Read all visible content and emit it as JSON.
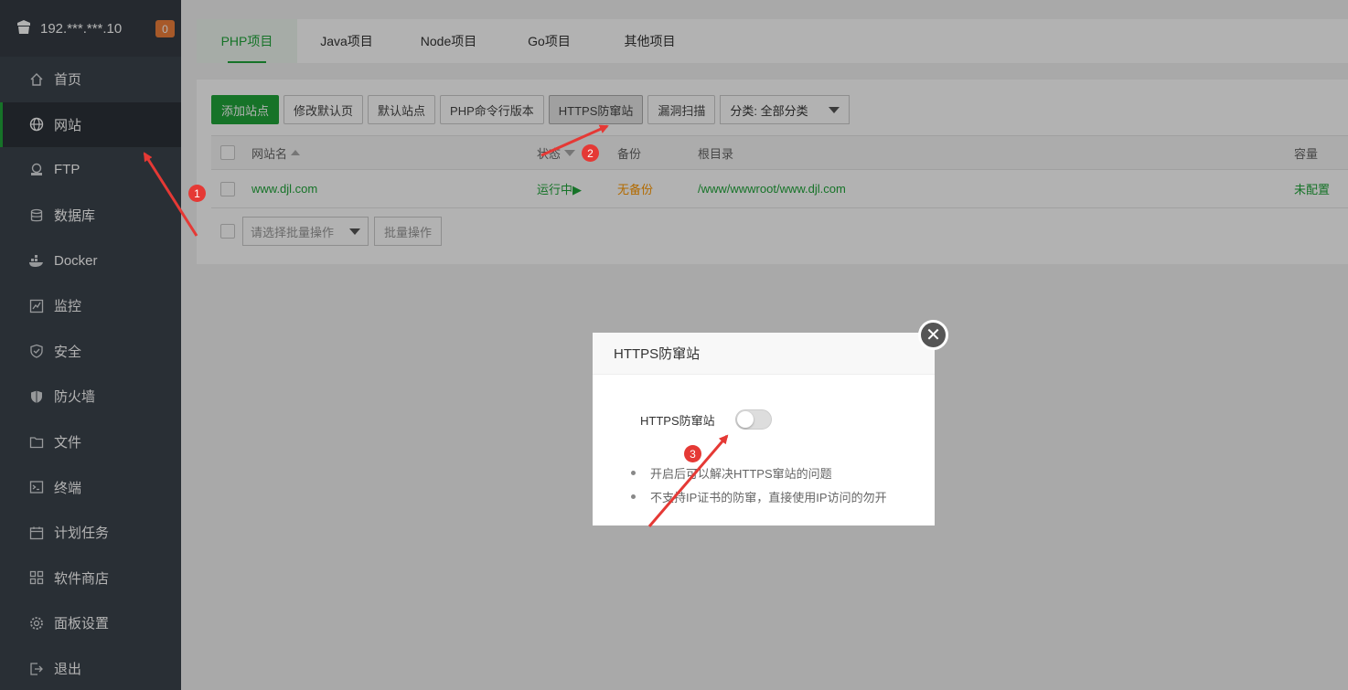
{
  "server": {
    "ip": "192.***.***.10",
    "notice_count": "0"
  },
  "sidebar": {
    "items": [
      {
        "label": "首页",
        "icon": "home-icon"
      },
      {
        "label": "网站",
        "icon": "globe-icon"
      },
      {
        "label": "FTP",
        "icon": "ftp-icon"
      },
      {
        "label": "数据库",
        "icon": "database-icon"
      },
      {
        "label": "Docker",
        "icon": "docker-icon"
      },
      {
        "label": "监控",
        "icon": "monitor-icon"
      },
      {
        "label": "安全",
        "icon": "shield-icon"
      },
      {
        "label": "防火墙",
        "icon": "firewall-icon"
      },
      {
        "label": "文件",
        "icon": "folder-icon"
      },
      {
        "label": "终端",
        "icon": "terminal-icon"
      },
      {
        "label": "计划任务",
        "icon": "calendar-icon"
      },
      {
        "label": "软件商店",
        "icon": "apps-icon"
      },
      {
        "label": "面板设置",
        "icon": "gear-icon"
      },
      {
        "label": "退出",
        "icon": "logout-icon"
      }
    ]
  },
  "tabs": [
    "PHP项目",
    "Java项目",
    "Node项目",
    "Go项目",
    "其他项目"
  ],
  "toolbar": {
    "add_site": "添加站点",
    "edit_default_page": "修改默认页",
    "default_site": "默认站点",
    "php_cli_version": "PHP命令行版本",
    "https_anti_hijack": "HTTPS防窜站",
    "vuln_scan": "漏洞扫描",
    "category_select": "分类: 全部分类"
  },
  "table": {
    "headers": {
      "name": "网站名",
      "status": "状态",
      "backup": "备份",
      "root": "根目录",
      "quota": "容量"
    },
    "rows": [
      {
        "name": "www.djl.com",
        "status": "运行中▶",
        "backup": "无备份",
        "root": "/www/wwwroot/www.djl.com",
        "quota": "未配置"
      }
    ]
  },
  "batch": {
    "placeholder": "请选择批量操作",
    "button": "批量操作"
  },
  "modal": {
    "title": "HTTPS防窜站",
    "field_label": "HTTPS防窜站",
    "toggle_on": false,
    "tips": [
      "开启后可以解决HTTPS窜站的问题",
      "不支持IP证书的防窜，直接使用IP访问的勿开"
    ]
  },
  "markers": [
    "1",
    "2",
    "3"
  ],
  "colors": {
    "accent": "#20a53a",
    "sidebar": "#3c444d",
    "warning": "#ff9900",
    "marker": "#e53935"
  }
}
